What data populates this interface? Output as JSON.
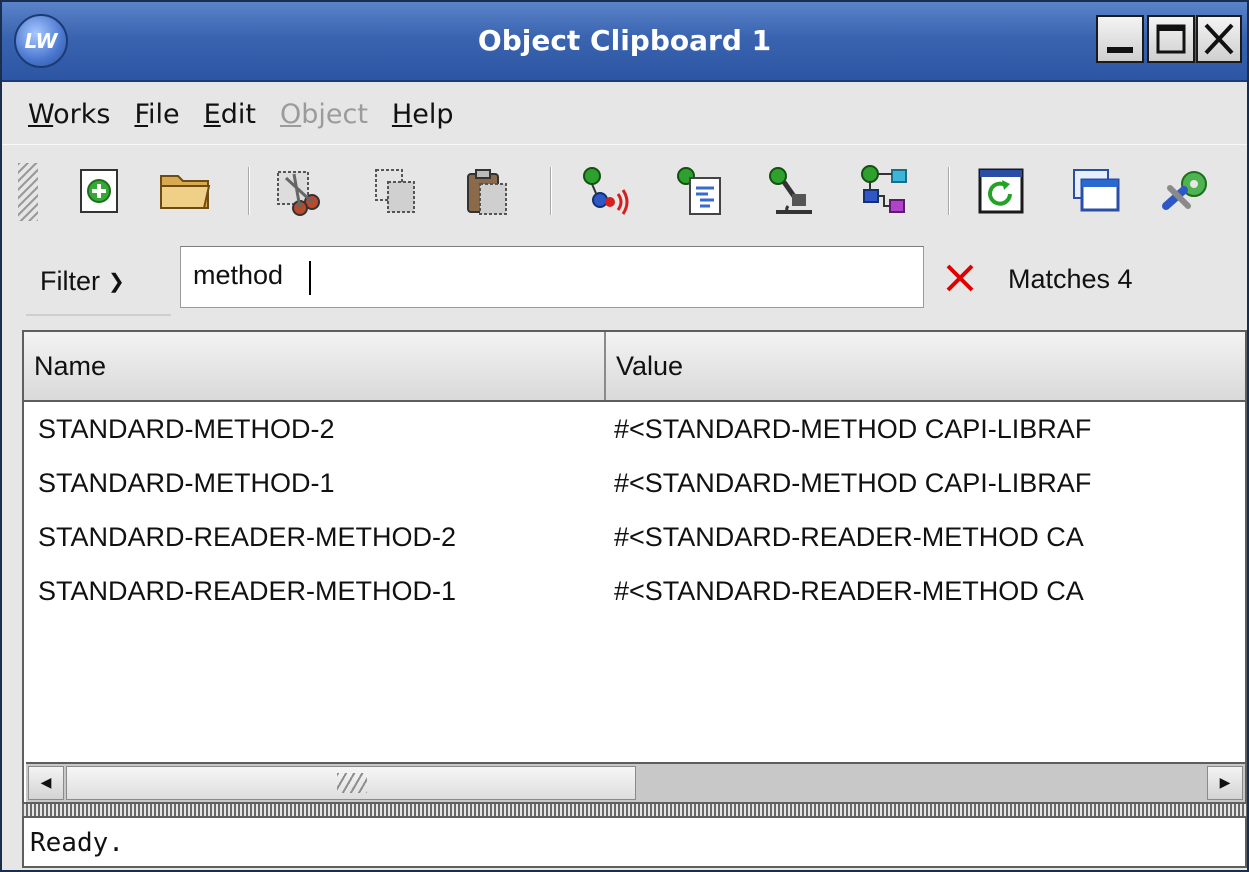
{
  "window": {
    "title": "Object Clipboard 1",
    "app_icon_text": "LW",
    "controls": [
      "minimize-icon",
      "maximize-icon",
      "close-icon"
    ]
  },
  "menu": [
    {
      "label": "Works",
      "mnemonic": "W",
      "rest": "orks",
      "enabled": true
    },
    {
      "label": "File",
      "mnemonic": "F",
      "rest": "ile",
      "enabled": true
    },
    {
      "label": "Edit",
      "mnemonic": "E",
      "rest": "dit",
      "enabled": true
    },
    {
      "label": "Object",
      "mnemonic": "O",
      "rest": "bject",
      "enabled": false
    },
    {
      "label": "Help",
      "mnemonic": "H",
      "rest": "elp",
      "enabled": true
    }
  ],
  "toolbar": {
    "icons": [
      "new-icon",
      "open-folder-icon",
      "cut-icon",
      "copy-icon",
      "paste-icon",
      "inspect-icon",
      "class-browser-icon",
      "inspector-icon",
      "graph-icon",
      "refresh-icon",
      "window-icon",
      "tools-icon"
    ]
  },
  "filter": {
    "label": "Filter",
    "value": "method",
    "matches_label": "Matches 4"
  },
  "table": {
    "columns": [
      "Name",
      "Value"
    ],
    "rows": [
      {
        "name": "STANDARD-METHOD-2",
        "value": "#<STANDARD-METHOD CAPI-LIBRAF"
      },
      {
        "name": "STANDARD-METHOD-1",
        "value": "#<STANDARD-METHOD CAPI-LIBRAF"
      },
      {
        "name": "STANDARD-READER-METHOD-2",
        "value": "#<STANDARD-READER-METHOD CA"
      },
      {
        "name": "STANDARD-READER-METHOD-1",
        "value": "#<STANDARD-READER-METHOD CA"
      }
    ]
  },
  "status": {
    "text": "Ready."
  },
  "colors": {
    "titlebar": "#3a64b0",
    "clear_x": "#e00000"
  }
}
